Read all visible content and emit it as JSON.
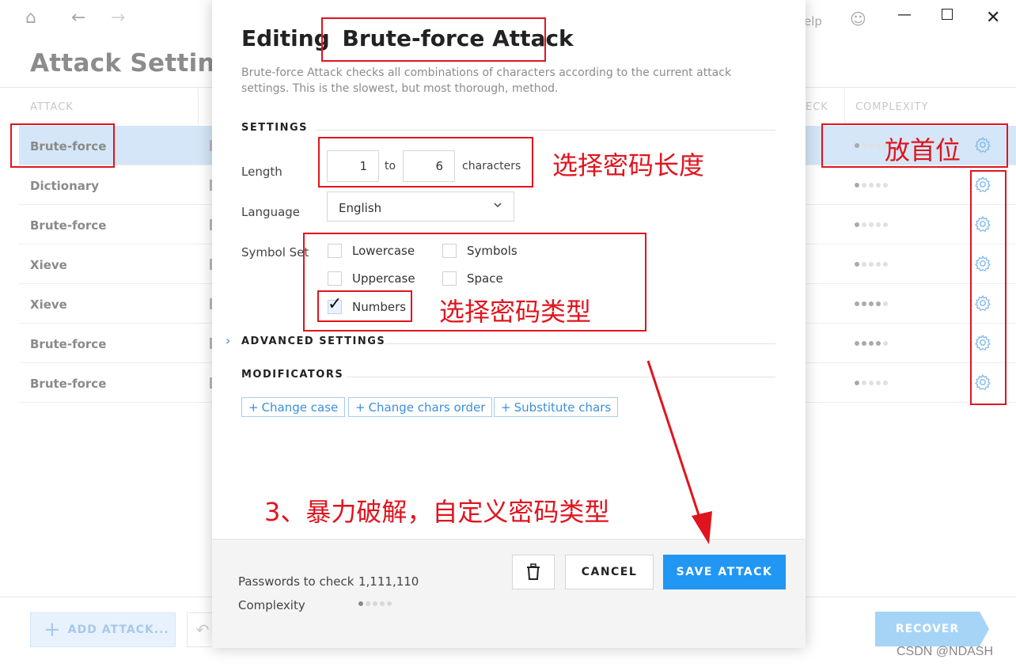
{
  "app": {
    "page_title": "Attack Settings",
    "help_text": "elp",
    "columns": [
      "ATTACK",
      "ECK",
      "COMPLEXITY"
    ],
    "rows": [
      {
        "name": "Brute-force",
        "complexity": 1,
        "selected": true
      },
      {
        "name": "Dictionary",
        "complexity": 1,
        "selected": false
      },
      {
        "name": "Brute-force",
        "complexity": 1,
        "selected": false
      },
      {
        "name": "Xieve",
        "complexity": 1,
        "selected": false
      },
      {
        "name": "Xieve",
        "complexity": 4,
        "selected": false
      },
      {
        "name": "Brute-force",
        "complexity": 4,
        "selected": false
      },
      {
        "name": "Brute-force",
        "complexity": 1,
        "selected": false
      }
    ],
    "add_attack_label": "ADD ATTACK...",
    "recover_label": "RECOVER"
  },
  "modal": {
    "title_prefix": "Editing",
    "title_name": "Brute-force Attack",
    "description": "Brute-force Attack checks all combinations of characters according to the current attack settings. This is the slowest, but most thorough, method.",
    "settings_title": "SETTINGS",
    "length_label": "Length",
    "length_from": "1",
    "length_to_word": "to",
    "length_to": "6",
    "characters_label": "characters",
    "language_label": "Language",
    "language_value": "English",
    "symbol_set_label": "Symbol Set",
    "symbol_sets": {
      "lowercase": {
        "label": "Lowercase",
        "checked": false
      },
      "symbols": {
        "label": "Symbols",
        "checked": false
      },
      "uppercase": {
        "label": "Uppercase",
        "checked": false
      },
      "space": {
        "label": "Space",
        "checked": false
      },
      "numbers": {
        "label": "Numbers",
        "checked": true
      }
    },
    "advanced_title": "ADVANCED SETTINGS",
    "modificators_title": "MODIFICATORS",
    "modificators": [
      "Change case",
      "Change chars order",
      "Substitute chars"
    ],
    "passwords_label": "Passwords to check",
    "passwords_value": "1,111,110",
    "complexity_label": "Complexity",
    "complexity_level": 1,
    "cancel_label": "CANCEL",
    "save_label": "SAVE ATTACK"
  },
  "annotations": {
    "length_note": "选择密码长度",
    "type_note": "选择密码类型",
    "first_note": "放首位",
    "step_note": "3、暴力破解，自定义密码类型"
  },
  "watermark": "CSDN @NDASH",
  "colors": {
    "accent": "#2196f3",
    "annotation": "#e0141e",
    "selected_row": "#d4e6f7"
  }
}
